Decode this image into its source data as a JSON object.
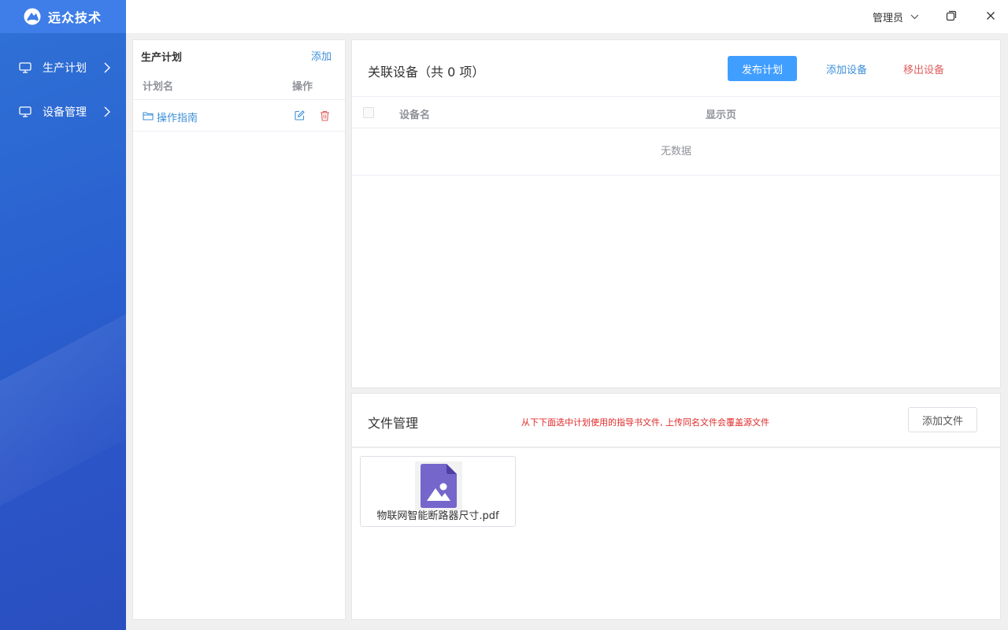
{
  "app": {
    "logo_text": "远众技术",
    "brand_color": "#3f7ee8",
    "accent_color": "#409eff",
    "danger_color": "#e06060"
  },
  "sidebar": {
    "items": [
      {
        "label": "生产计划",
        "icon": "monitor-icon"
      },
      {
        "label": "设备管理",
        "icon": "monitor-icon"
      }
    ]
  },
  "topbar": {
    "user_label": "管理员",
    "icons": [
      "chevron-down-icon",
      "restore-window-icon",
      "close-icon"
    ]
  },
  "plan_panel": {
    "title": "生产计划",
    "add_label": "添加",
    "columns": [
      "计划名",
      "操作"
    ],
    "rows": [
      {
        "name": "操作指南",
        "icons": [
          "folder-icon",
          "edit-icon",
          "delete-icon"
        ]
      }
    ]
  },
  "device_panel": {
    "title": "关联设备（共 0 项）",
    "publish_label": "发布计划",
    "add_device_label": "添加设备",
    "remove_device_label": "移出设备",
    "columns": [
      "设备名",
      "显示页"
    ],
    "empty_text": "无数据"
  },
  "file_panel": {
    "title": "文件管理",
    "hint": "从下下面选中计划使用的指导书文件, 上传同名文件会覆盖源文件",
    "add_file_label": "添加文件",
    "files": [
      {
        "name": "物联网智能断路器尺寸.pdf",
        "icon": "image-file-icon"
      }
    ]
  }
}
